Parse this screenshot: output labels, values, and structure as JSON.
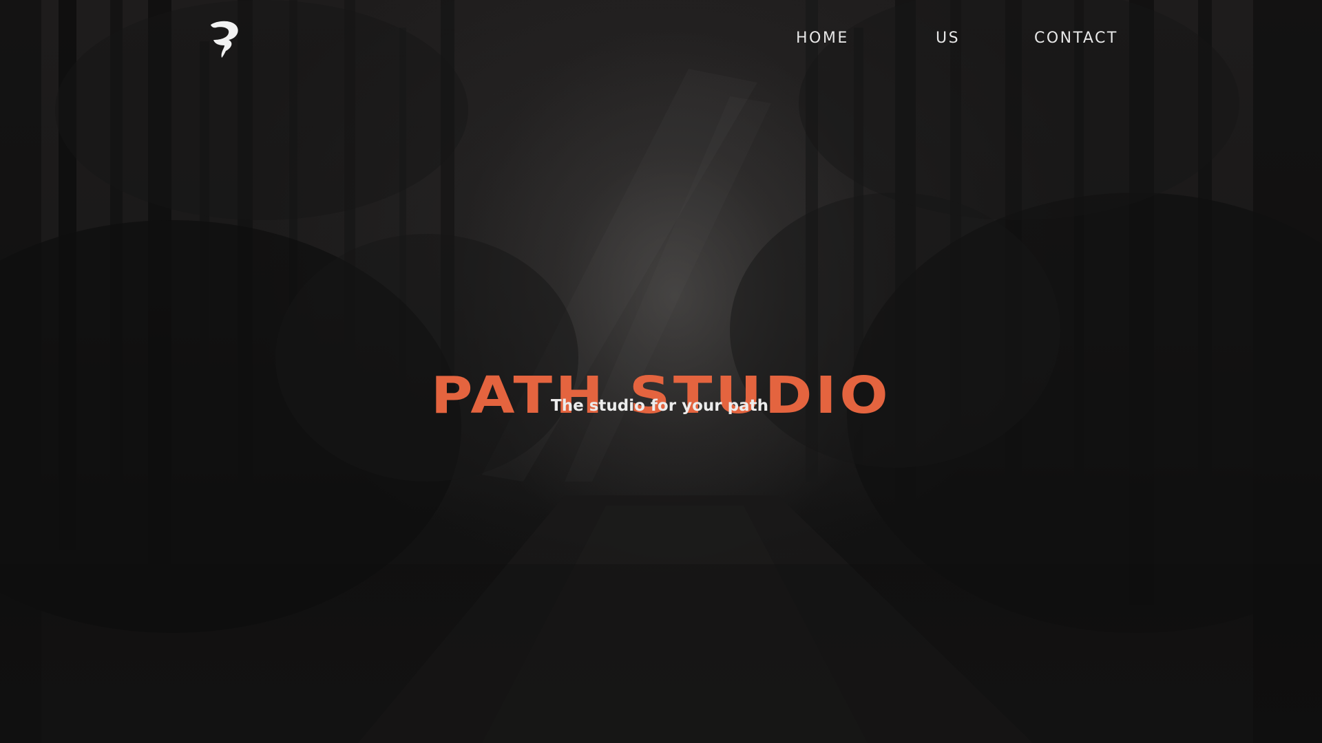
{
  "nav": {
    "logo_icon": "path-studio-logo-icon",
    "links": [
      {
        "label": "HOME"
      },
      {
        "label": "US"
      },
      {
        "label": "CONTACT"
      }
    ]
  },
  "hero": {
    "title": "PATH STUDIO",
    "subtitle": "The studio for your path",
    "background": "dark forest path photograph"
  },
  "colors": {
    "accent": "#e4643f",
    "text": "#ececec",
    "background": "#141313"
  }
}
